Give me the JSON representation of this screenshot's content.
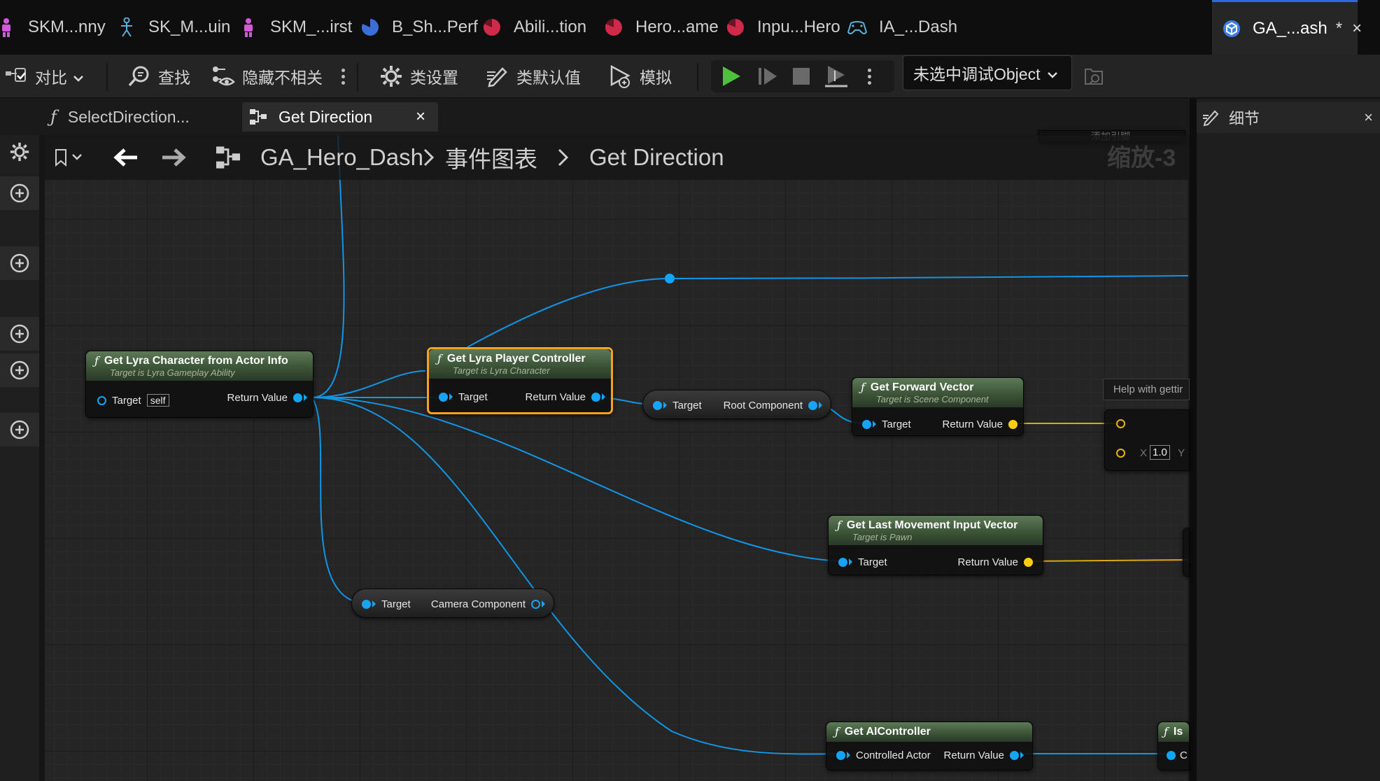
{
  "asset_tabs": [
    {
      "label": "SKM...nny",
      "icon": "skeletal-mesh-icon",
      "color": "#d15ad7"
    },
    {
      "label": "SK_M...uin",
      "icon": "skeleton-icon",
      "color": "#5ab0d7"
    },
    {
      "label": "SKM_...irst",
      "icon": "skeletal-mesh-icon",
      "color": "#d15ad7"
    },
    {
      "label": "B_Sh...Perf",
      "icon": "blueprint-pie-icon",
      "color": "#3b6fd8"
    },
    {
      "label": "Abili...tion",
      "icon": "data-asset-pie-icon",
      "color": "#d02a4a"
    },
    {
      "label": "Hero...ame",
      "icon": "data-asset-pie-icon",
      "color": "#d02a4a"
    },
    {
      "label": "Inpu...Hero",
      "icon": "data-asset-pie-icon",
      "color": "#d02a4a"
    },
    {
      "label": "IA_...Dash",
      "icon": "input-action-icon",
      "color": "#5ab0d7"
    },
    {
      "label": "GA_...ash",
      "icon": "blueprint-icon",
      "color": "#3b7fe8",
      "dirty_mark": "*",
      "active": true
    }
  ],
  "toolbar": {
    "diff": "对比",
    "find": "查找",
    "hide_unrelated": "隐藏不相关",
    "class_settings": "类设置",
    "class_defaults": "类默认值",
    "simulate": "模拟",
    "debug_object": "未选中调试Object"
  },
  "doc_tabs": [
    {
      "label": "SelectDirection...",
      "icon": "function-icon"
    },
    {
      "label": "Get Direction",
      "icon": "graph-icon",
      "active": true
    }
  ],
  "details_panel": {
    "title": "细节"
  },
  "breadcrumb": {
    "items": [
      "GA_Hero_Dash",
      "事件图表",
      "Get Direction"
    ],
    "zoom": "缩放-3"
  },
  "nodes": {
    "get_lyra_character": {
      "title": "Get Lyra Character from Actor Info",
      "subtitle": "Target is Lyra Gameplay Ability",
      "in_pin": "Target",
      "in_default": "self",
      "out_pin": "Return Value"
    },
    "get_lyra_player_controller": {
      "title": "Get Lyra Player Controller",
      "subtitle": "Target is Lyra Character",
      "in_pin": "Target",
      "out_pin": "Return Value"
    },
    "root_component": {
      "in_pin": "Target",
      "out_pin": "Root Component"
    },
    "get_forward_vector": {
      "title": "Get Forward Vector",
      "subtitle": "Target is Scene Component",
      "in_pin": "Target",
      "out_pin": "Return Value"
    },
    "get_last_movement_input": {
      "title": "Get Last Movement Input Vector",
      "subtitle": "Target is Pawn",
      "in_pin": "Target",
      "out_pin": "Return Value"
    },
    "camera_component": {
      "in_pin": "Target",
      "out_pin": "Camera Component"
    },
    "get_ai_controller": {
      "title": "Get AIController",
      "in_pin": "Controlled Actor",
      "out_pin": "Return Value"
    },
    "partial_right_node": {
      "title": "Is",
      "in_pin": "C"
    },
    "vector_node": {
      "x_label": "X",
      "x_value": "1.0",
      "y_label": "Y"
    }
  },
  "tooltip": "Help with gettir",
  "top_partial_text": "添加引脚",
  "colors": {
    "object_pin": "#15a4f7",
    "vector_pin": "#ffcc12",
    "selection": "#f5a31b",
    "play_green": "#4ec13c"
  }
}
